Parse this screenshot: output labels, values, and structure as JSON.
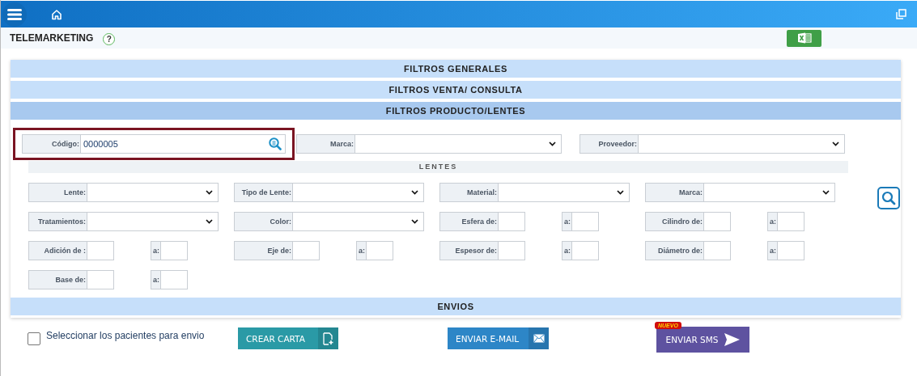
{
  "page": {
    "title": "TELEMARKETING",
    "help": "?"
  },
  "sections": [
    {
      "title": "FILTROS GENERALES",
      "expanded": false
    },
    {
      "title": "FILTROS VENTA/ CONSULTA",
      "expanded": false
    },
    {
      "title": "FILTROS PRODUCTO/LENTES",
      "expanded": true
    },
    {
      "title": "ENVIOS",
      "expanded": false
    }
  ],
  "product_filters": {
    "top_fields": [
      {
        "kind": "search",
        "label": "Código:",
        "value": "0000005",
        "highlighted": true
      },
      {
        "kind": "select",
        "label": "Marca:",
        "highlighted": false
      },
      {
        "kind": "select",
        "label": "Proveedor:",
        "highlighted": false
      }
    ],
    "lentes": {
      "title": "LENTES",
      "rows": [
        [
          {
            "kind": "select",
            "label": "Lente:"
          },
          {
            "kind": "select",
            "label": "Tipo de Lente:"
          },
          {
            "kind": "select",
            "label": "Material:"
          },
          {
            "kind": "select",
            "label": "Marca:"
          }
        ],
        [
          {
            "kind": "select",
            "label": "Tratamientos:"
          },
          {
            "kind": "select",
            "label": "Color:"
          },
          {
            "kind": "range",
            "label": "Esfera de:",
            "to_label": "a:"
          },
          {
            "kind": "range",
            "label": "Cilindro de:",
            "to_label": "a:"
          }
        ],
        [
          {
            "kind": "range",
            "label": "Adición de :",
            "to_label": "a:"
          },
          {
            "kind": "range",
            "label": "Eje de:",
            "to_label": "a:"
          },
          {
            "kind": "range",
            "label": "Espesor de:",
            "to_label": "a:"
          },
          {
            "kind": "range",
            "label": "Diámetro de:",
            "to_label": "a:"
          }
        ],
        [
          {
            "kind": "range",
            "label": "Base de:",
            "to_label": "a:"
          }
        ]
      ]
    }
  },
  "envios": {
    "checkbox": {
      "label": "Seleccionar los pacientes para envio",
      "checked": false
    },
    "buttons": [
      {
        "kind": "letter",
        "label": "CREAR CARTA"
      },
      {
        "kind": "email",
        "label": "ENVIAR E-MAIL"
      },
      {
        "kind": "sms",
        "label": "ENVIAR SMS",
        "badge": "NUEVO"
      }
    ]
  }
}
